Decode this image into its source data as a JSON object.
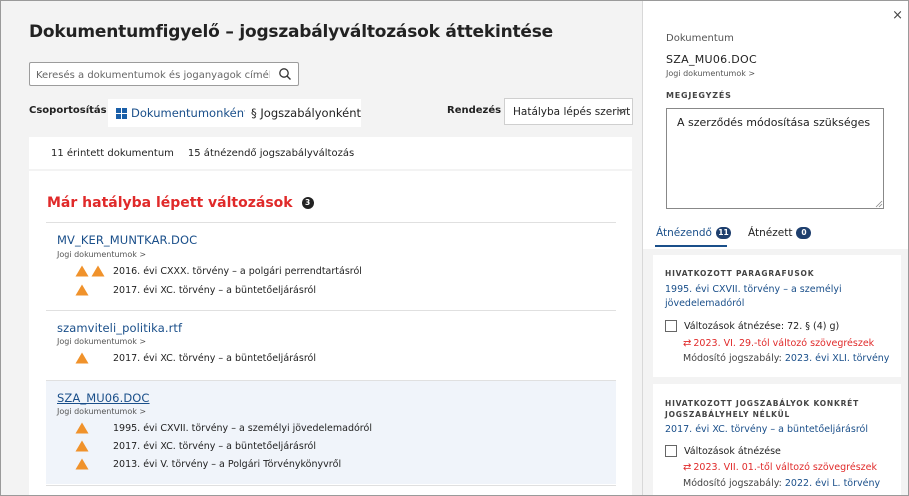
{
  "page": {
    "title": "Dokumentumfigyelő – jogszabályváltozások áttekintése",
    "search_placeholder": "Keresés a dokumentumok és joganyagok címében",
    "grouping_label": "Csoportosítás",
    "group_by_document": "Dokumentumonként",
    "group_by_law": "§ Jogszabályonként",
    "sort_label": "Rendezés",
    "sort_value": "Hatályba lépés szerint",
    "stats": {
      "affected_docs": "11 érintett dokumentum",
      "changes_to_review": "15 átnézendő jogszabályváltozás"
    }
  },
  "section": {
    "title": "Már hatályba lépett változások",
    "count": "3"
  },
  "documents": [
    {
      "name": "MV_KER_MUNTKAR.DOC",
      "sub": "Jogi dokumentumok >",
      "laws": [
        {
          "text": "2016. évi CXXX. törvény – a polgári perrendtartásról",
          "warnings": 2
        },
        {
          "text": "2017. évi XC. törvény – a büntetőeljárásról",
          "warnings": 1
        }
      ]
    },
    {
      "name": "szamviteli_politika.rtf",
      "sub": "Jogi dokumentumok >",
      "laws": [
        {
          "text": "2017. évi XC. törvény – a büntetőeljárásról",
          "warnings": 1
        }
      ]
    },
    {
      "name": "SZA_MU06.DOC",
      "sub": "Jogi dokumentumok >",
      "laws": [
        {
          "text": "1995. évi CXVII. törvény – a személyi jövedelemadóról",
          "warnings": 1
        },
        {
          "text": "2017. évi XC. törvény – a büntetőeljárásról",
          "warnings": 1
        },
        {
          "text": "2013. évi V. törvény – a Polgári Törvénykönyvről",
          "warnings": 1
        }
      ]
    }
  ],
  "panel": {
    "close": "×",
    "doc_label": "Dokumentum",
    "doc_name": "SZA_MU06.DOC",
    "doc_sub": "Jogi dokumentumok >",
    "note_label": "MEGJEGYZÉS",
    "note_value": "A szerződés módosítása szükséges",
    "tabs": [
      {
        "label": "Átnézendő",
        "count": "11"
      },
      {
        "label": "Átnézett",
        "count": "0"
      }
    ],
    "refs": [
      {
        "heading": "HIVATKOZOTT PARAGRAFUSOK",
        "law_link": "1995. évi CXVII. törvény – a személyi jövedelemadóról",
        "check_label": "Változások átnézése: 72. § (4) g)",
        "change": "2023. VI. 29.-tól változó szövegrészek",
        "modifier_label": "Módosító jogszabály: ",
        "modifier_link": "2023. évi XLI. törvény"
      },
      {
        "heading": "HIVATKOZOTT JOGSZABÁLYOK KONKRÉT JOGSZABÁLYHELY NÉLKÜL",
        "law_link": "2017. évi XC. törvény – a büntetőeljárásról",
        "check_label": "Változások átnézése",
        "change": "2023. VII. 01.-től változó szövegrészek",
        "modifier_label": "Módosító jogszabály: ",
        "modifier_link": "2022. évi L. törvény"
      }
    ]
  },
  "colors": {
    "accent": "#1a4f8a",
    "alert": "#e02a2a",
    "warning": "#f0922b"
  }
}
